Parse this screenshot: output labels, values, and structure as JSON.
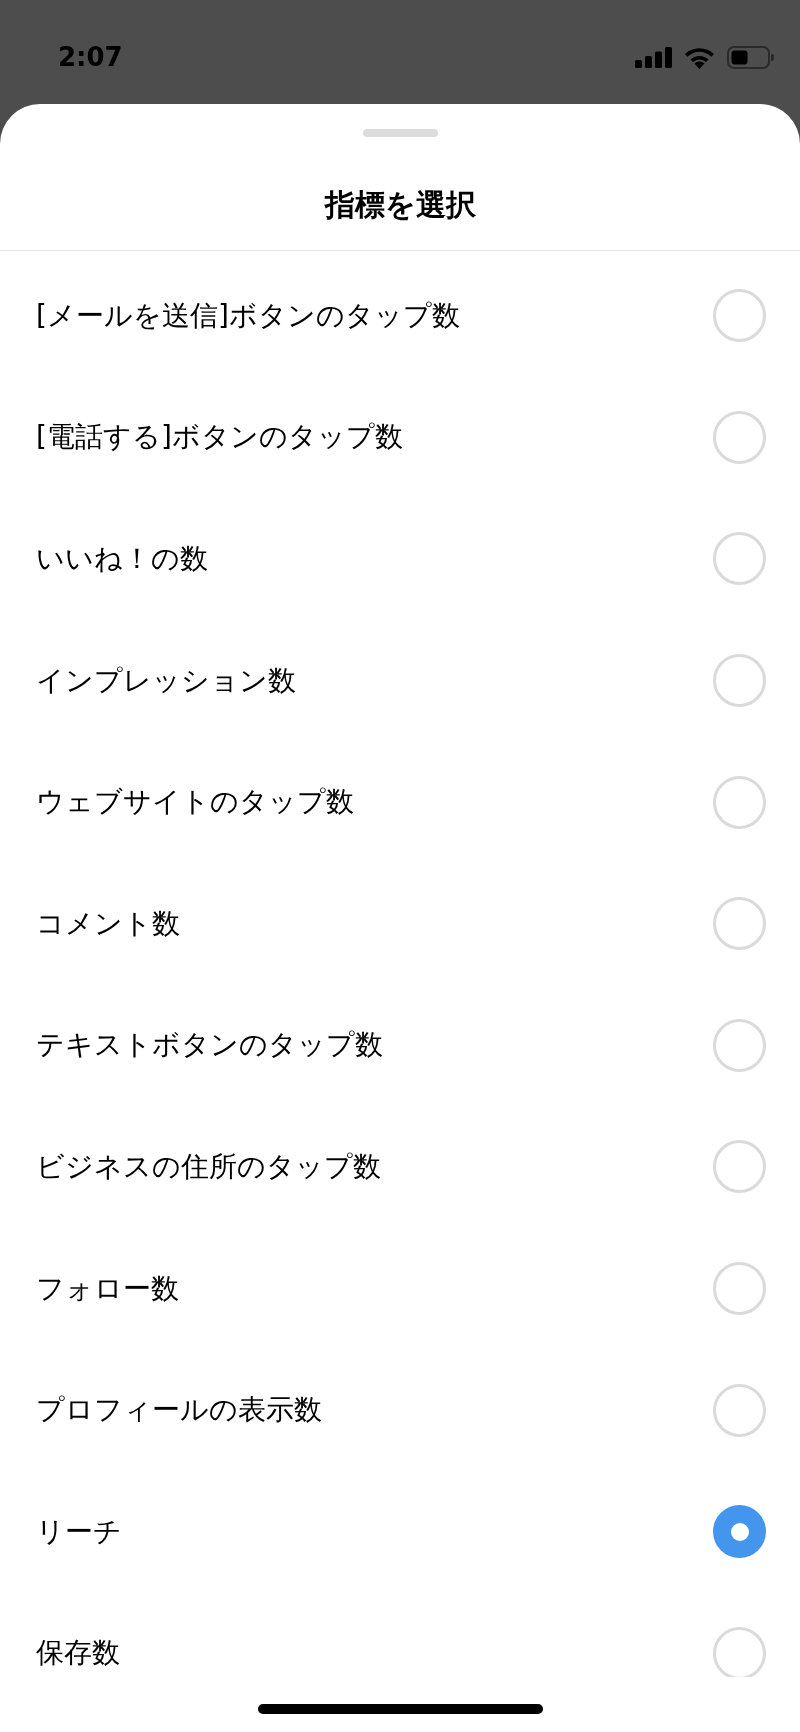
{
  "status_bar": {
    "time": "2:07"
  },
  "sheet": {
    "title": "指標を選択"
  },
  "options": [
    {
      "label": "[メールを送信]ボタンのタップ数",
      "selected": false
    },
    {
      "label": "[電話する]ボタンのタップ数",
      "selected": false
    },
    {
      "label": "いいね！の数",
      "selected": false
    },
    {
      "label": "インプレッション数",
      "selected": false
    },
    {
      "label": "ウェブサイトのタップ数",
      "selected": false
    },
    {
      "label": "コメント数",
      "selected": false
    },
    {
      "label": "テキストボタンのタップ数",
      "selected": false
    },
    {
      "label": "ビジネスの住所のタップ数",
      "selected": false
    },
    {
      "label": "フォロー数",
      "selected": false
    },
    {
      "label": "プロフィールの表示数",
      "selected": false
    },
    {
      "label": "リーチ",
      "selected": true
    },
    {
      "label": "保存数",
      "selected": false
    }
  ]
}
